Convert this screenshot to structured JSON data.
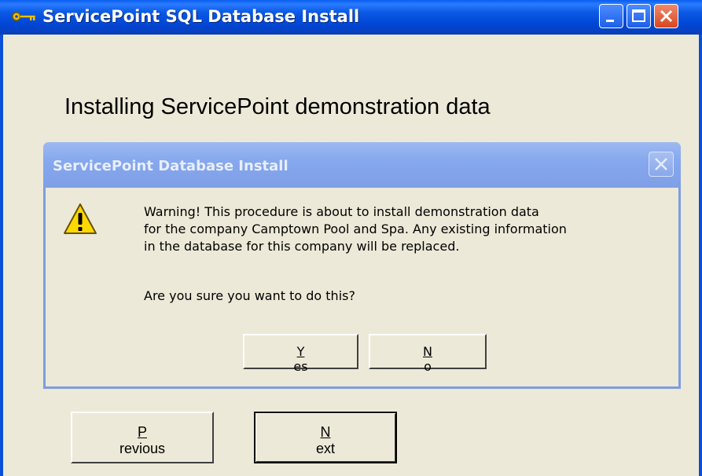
{
  "main_window": {
    "title": "ServicePoint SQL Database Install",
    "heading": "Installing ServicePoint demonstration data",
    "buttons": {
      "previous": {
        "mnemonic": "P",
        "rest": "revious"
      },
      "next": {
        "mnemonic": "N",
        "rest": "ext"
      }
    }
  },
  "dialog": {
    "title": "ServicePoint Database Install",
    "message": "Warning!  This procedure is about to install demonstration data\nfor the company Camptown Pool and Spa.  Any existing information\nin the database for this company will be replaced.",
    "question": "Are you sure you want to do this?",
    "buttons": {
      "yes": {
        "mnemonic": "Y",
        "rest": "es"
      },
      "no": {
        "mnemonic": "N",
        "rest": "o"
      }
    }
  },
  "icons": {
    "app": "key-icon",
    "warning": "warning-icon",
    "minimize": "minimize-icon",
    "maximize": "maximize-icon",
    "close": "close-icon"
  },
  "colors": {
    "titlebar": "#0046d5",
    "dialog_titlebar_inactive": "#86a8ee",
    "close_button": "#d8461f",
    "face": "#ece9d8"
  }
}
